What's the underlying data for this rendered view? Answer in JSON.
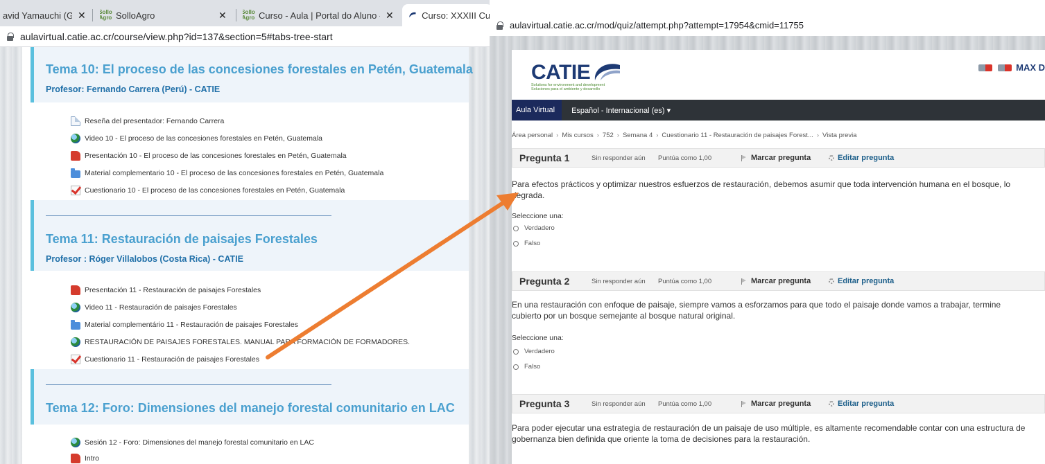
{
  "left_window": {
    "tabs": [
      {
        "title": "avid Yamauchi (Gra",
        "close": "✕"
      },
      {
        "title": "SolloAgro",
        "close": "✕",
        "favicon": "Sollo Agro"
      },
      {
        "title": "Curso - Aula | Portal do Aluno - S",
        "close": "✕",
        "favicon": "Sollo Agro"
      },
      {
        "title": "Curso: XXXIII Curso I"
      }
    ],
    "address": "aulavirtual.catie.ac.cr/course/view.php?id=137&section=5#tabs-tree-start",
    "sections": [
      {
        "title": "Tema 10: El proceso de las concesiones forestales en Petén, Guatemala",
        "professor": "Profesor: Fernando Carrera (Perú) - CATIE",
        "activities": [
          {
            "icon": "document-icon",
            "label": "Reseña del presentador: Fernando Carrera"
          },
          {
            "icon": "video-icon",
            "label": "Video 10 - El proceso de las concesiones forestales en Petén, Guatemala"
          },
          {
            "icon": "presentation-icon",
            "label": "Presentación 10 - El proceso de las concesiones forestales en Petén, Guatemala"
          },
          {
            "icon": "folder-icon",
            "label": "Material complementario 10 - El proceso de las concesiones forestales en Petén, Guatemala"
          },
          {
            "icon": "quiz-icon",
            "label": "Cuestionario 10 - El proceso de las concesiones forestales en Petén, Guatemala"
          }
        ]
      },
      {
        "title": "Tema 11: Restauración de paisajes Forestales",
        "professor": "Profesor : Róger Villalobos (Costa Rica) - CATIE",
        "activities": [
          {
            "icon": "presentation-icon",
            "label": "Presentación 11 - Restauración de paisajes Forestales"
          },
          {
            "icon": "video-icon",
            "label": "Video 11 - Restauración de paisajes Forestales"
          },
          {
            "icon": "folder-icon",
            "label": "Material complementário 11 - Restauración de paisajes Forestales"
          },
          {
            "icon": "video-icon",
            "label": "RESTAURACIÓN DE PAISAJES FORESTALES. MANUAL PARA FORMACIÓN DE FORMADORES."
          },
          {
            "icon": "quiz-icon",
            "label": "Cuestionario 11 - Restauración de paisajes Forestales"
          }
        ]
      },
      {
        "title": "Tema 12: Foro: Dimensiones del manejo forestal comunitario en LAC",
        "activities": [
          {
            "icon": "video-icon",
            "label": "Sesión 12 - Foro: Dimensiones del manejo forestal comunitario en LAC"
          },
          {
            "icon": "presentation-icon",
            "label": "Intro"
          }
        ]
      }
    ]
  },
  "right_window": {
    "address": "aulavirtual.catie.ac.cr/mod/quiz/attempt.php?attempt=17954&cmid=11755",
    "logo": {
      "text": "CATIE",
      "sub1": "Solutions for environment and development",
      "sub2": "Soluciones para el ambiente y desarrollo"
    },
    "user": "MAX D",
    "nav": {
      "brand": "Aula Virtual",
      "lang": "Español - Internacional (es) ▾"
    },
    "breadcrumb": [
      "Área personal",
      "Mis cursos",
      "752",
      "Semana 4",
      "Cuestionario 11 - Restauración de paisajes Forest...",
      "Vista previa"
    ],
    "breadcrumb_sep": "›",
    "questions": [
      {
        "title": "Pregunta 1",
        "state": "Sin responder aún",
        "grade": "Puntúa como 1,00",
        "flag": "Marcar pregunta",
        "edit": "Editar pregunta",
        "text": "Para efectos prácticos y optimizar nuestros esfuerzos de restauración, debemos asumir que toda intervención humana en el bosque, lo degrada.",
        "select_label": "Seleccione una:",
        "options": [
          "Verdadero",
          "Falso"
        ]
      },
      {
        "title": "Pregunta 2",
        "state": "Sin responder aún",
        "grade": "Puntúa como 1,00",
        "flag": "Marcar pregunta",
        "edit": "Editar pregunta",
        "text": "En una restauración con enfoque de paisaje, siempre vamos a esforzamos para que todo el paisaje donde vamos a trabajar, termine cubierto por un bosque semejante al bosque natural original.",
        "select_label": "Seleccione una:",
        "options": [
          "Verdadero",
          "Falso"
        ]
      },
      {
        "title": "Pregunta 3",
        "state": "Sin responder aún",
        "grade": "Puntúa como 1,00",
        "flag": "Marcar pregunta",
        "edit": "Editar pregunta",
        "text": "Para poder ejecutar una estrategia de restauración de un paisaje de uso múltiple, es altamente recomendable contar con una estructura de gobernanza bien definida que oriente la toma de decisiones para la restauración."
      }
    ]
  },
  "colors": {
    "section_title": "#4aa0cf",
    "professor": "#1f6fa8",
    "arrow": "#ed7d31",
    "navbar": "#2e3338",
    "catie_blue": "#1d3a74"
  }
}
